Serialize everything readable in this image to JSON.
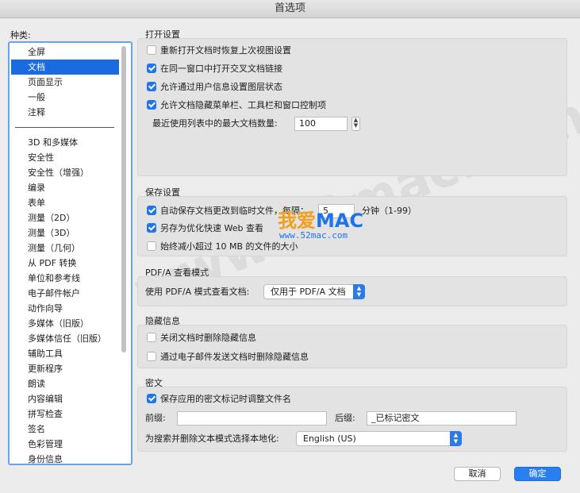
{
  "window": {
    "title": "首选项"
  },
  "sidebar": {
    "label": "种类:",
    "top_items": [
      {
        "label": "全屏",
        "selected": false
      },
      {
        "label": "文档",
        "selected": true
      },
      {
        "label": "页面显示",
        "selected": false
      },
      {
        "label": "一般",
        "selected": false
      },
      {
        "label": "注释",
        "selected": false
      }
    ],
    "items": [
      "3D 和多媒体",
      "安全性",
      "安全性（增强）",
      "编录",
      "表单",
      "测量（2D）",
      "测量（3D）",
      "测量（几何）",
      "从 PDF 转换",
      "单位和参考线",
      "电子邮件帐户",
      "动作向导",
      "多媒体（旧版）",
      "多媒体信任（旧版）",
      "辅助工具",
      "更新程序",
      "朗读",
      "内容编辑",
      "拼写检查",
      "签名",
      "色彩管理",
      "身份信息"
    ]
  },
  "open_settings": {
    "title": "打开设置",
    "options": [
      {
        "label": "重新打开文档时恢复上次视图设置",
        "checked": false
      },
      {
        "label": "在同一窗口中打开交叉文档链接",
        "checked": true
      },
      {
        "label": "允许通过用户信息设置图层状态",
        "checked": true
      },
      {
        "label": "允许文档隐藏菜单栏、工具栏和窗口控制项",
        "checked": true
      }
    ],
    "recent_label": "最近使用列表中的最大文档数量:",
    "recent_value": "100"
  },
  "save_settings": {
    "title": "保存设置",
    "autosave_label": "自动保存文档更改到临时文件，每隔：",
    "autosave_value": "5",
    "autosave_unit": "分钟（1-99）",
    "optimize_label": "另存为优化快速 Web 查看",
    "optimize_checked": true,
    "autosave_checked": true,
    "reduce_label": "始终减小超过 10 MB 的文件的大小",
    "reduce_checked": false
  },
  "pdfa": {
    "title": "PDF/A 查看模式",
    "label": "使用 PDF/A 模式查看文档:",
    "selected": "仅用于 PDF/A 文档"
  },
  "hidden_info": {
    "title": "隐藏信息",
    "options": [
      {
        "label": "关闭文档时删除隐藏信息",
        "checked": false
      },
      {
        "label": "通过电子邮件发送文档时删除隐藏信息",
        "checked": false
      }
    ]
  },
  "redaction": {
    "title": "密文",
    "adjust_label": "保存应用的密文标记时调整文件名",
    "adjust_checked": true,
    "prefix_label": "前缀:",
    "prefix_value": "",
    "suffix_label": "后缀:",
    "suffix_value": "_已标记密文",
    "locale_label": "为搜索并删除文本模式选择本地化:",
    "locale_value": "English (US)"
  },
  "buttons": {
    "cancel": "取消",
    "ok": "确定"
  },
  "watermark": {
    "brand_a": "我爱",
    "brand_b": "MAC",
    "url": "www.52mac.com",
    "big": "www.52mac.com"
  },
  "colors": {
    "accent": "#1f75ea",
    "selection": "#1a6be0",
    "watermark_orange": "#f0a020"
  }
}
